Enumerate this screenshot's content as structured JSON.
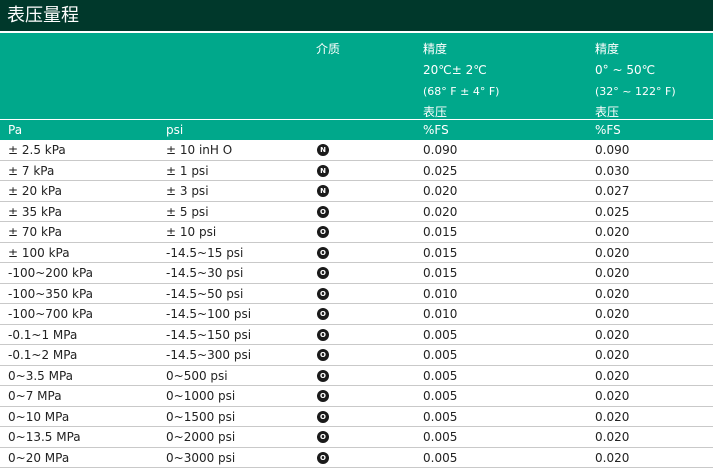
{
  "title": "表压量程",
  "header": {
    "media": "介质",
    "acc1_line1": "精度",
    "acc1_line2": "20℃± 2℃",
    "acc1_line3": "(68° F ± 4° F)",
    "acc1_line4": "表压",
    "acc2_line1": "精度",
    "acc2_line2": "0° ~ 50℃",
    "acc2_line3": "(32° ~ 122° F)",
    "acc2_line4": "表压"
  },
  "units": {
    "pa": "Pa",
    "psi": "psi",
    "fs1": "%FS",
    "fs2": "%FS"
  },
  "rows": [
    {
      "pa": "± 2.5 kPa",
      "psi": "± 10 inH O",
      "media": "N",
      "acc1": "0.090",
      "acc2": "0.090"
    },
    {
      "pa": "± 7 kPa",
      "psi": "± 1 psi",
      "media": "N",
      "acc1": "0.025",
      "acc2": "0.030"
    },
    {
      "pa": "± 20 kPa",
      "psi": "± 3 psi",
      "media": "N",
      "acc1": "0.020",
      "acc2": "0.027"
    },
    {
      "pa": "± 35 kPa",
      "psi": "± 5 psi",
      "media": "O",
      "acc1": "0.020",
      "acc2": "0.025"
    },
    {
      "pa": "± 70 kPa",
      "psi": "± 10 psi",
      "media": "O",
      "acc1": "0.015",
      "acc2": "0.020"
    },
    {
      "pa": "± 100 kPa",
      "psi": "-14.5~15 psi",
      "media": "O",
      "acc1": "0.015",
      "acc2": "0.020"
    },
    {
      "pa": "-100~200 kPa",
      "psi": "-14.5~30 psi",
      "media": "O",
      "acc1": "0.015",
      "acc2": "0.020"
    },
    {
      "pa": "-100~350 kPa",
      "psi": "-14.5~50 psi",
      "media": "O",
      "acc1": "0.010",
      "acc2": "0.020"
    },
    {
      "pa": "-100~700 kPa",
      "psi": "-14.5~100 psi",
      "media": "O",
      "acc1": "0.010",
      "acc2": "0.020"
    },
    {
      "pa": "-0.1~1 MPa",
      "psi": "-14.5~150 psi",
      "media": "O",
      "acc1": "0.005",
      "acc2": "0.020"
    },
    {
      "pa": "-0.1~2 MPa",
      "psi": "-14.5~300 psi",
      "media": "O",
      "acc1": "0.005",
      "acc2": "0.020"
    },
    {
      "pa": "0~3.5 MPa",
      "psi": "0~500 psi",
      "media": "O",
      "acc1": "0.005",
      "acc2": "0.020"
    },
    {
      "pa": "0~7 MPa",
      "psi": "0~1000 psi",
      "media": "O",
      "acc1": "0.005",
      "acc2": "0.020"
    },
    {
      "pa": "0~10 MPa",
      "psi": "0~1500 psi",
      "media": "O",
      "acc1": "0.005",
      "acc2": "0.020"
    },
    {
      "pa": "0~13.5 MPa",
      "psi": "0~2000 psi",
      "media": "O",
      "acc1": "0.005",
      "acc2": "0.020"
    },
    {
      "pa": "0~20 MPa",
      "psi": "0~3000 psi",
      "media": "O",
      "acc1": "0.005",
      "acc2": "0.020"
    }
  ]
}
